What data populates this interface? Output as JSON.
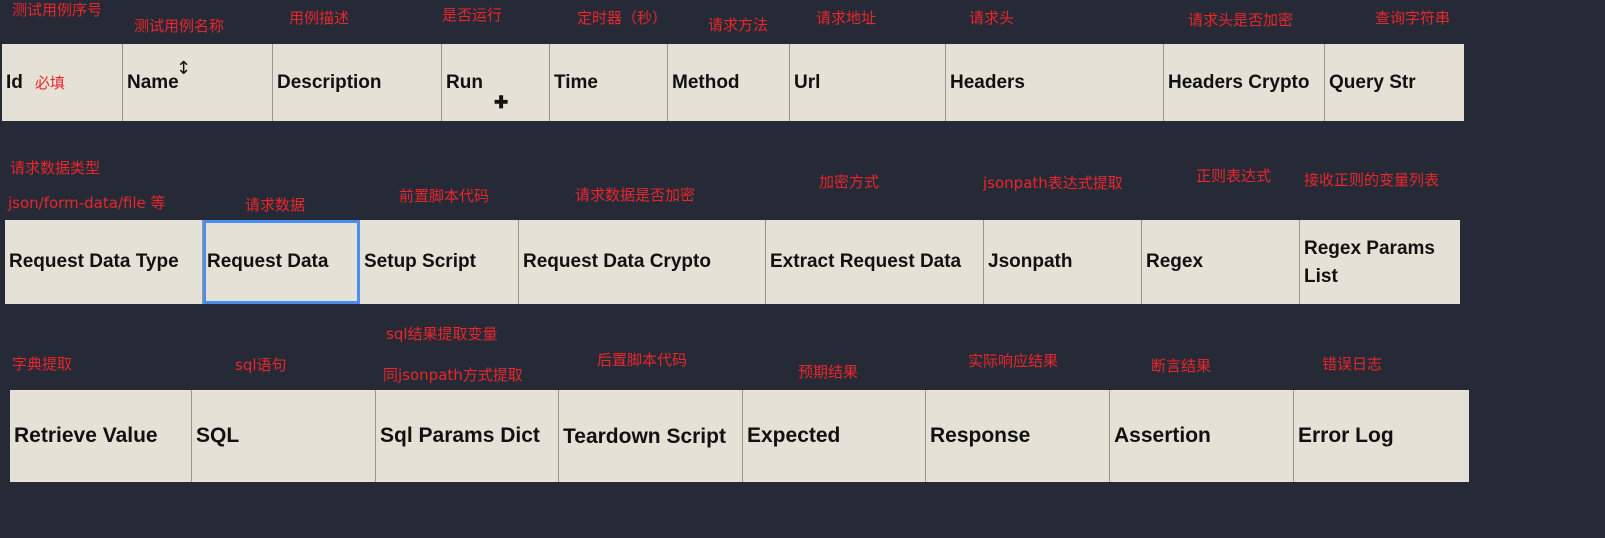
{
  "annotations_row1": [
    "测试用例序号",
    "测试用例名称",
    "用例描述",
    "是否运行",
    "定时器（秒）",
    "请求方法",
    "请求地址",
    "请求头",
    "请求头是否加密",
    "查询字符串"
  ],
  "annotations_row2": [
    "请求数据类型",
    "json/form-data/file 等",
    "请求数据",
    "前置脚本代码",
    "请求数据是否加密",
    "加密方式",
    "jsonpath表达式提取",
    "正则表达式",
    "接收正则的变量列表"
  ],
  "annotations_row3": [
    "字典提取",
    "sql语句",
    "sql结果提取变量",
    "同jsonpath方式提取",
    "后置脚本代码",
    "预期结果",
    "实际响应结果",
    "断言结果",
    "错误日志"
  ],
  "id_note": "必填",
  "row1": [
    "Id",
    "Name",
    "Description",
    "Run",
    "Time",
    "Method",
    "Url",
    "Headers",
    "Headers Crypto",
    "Query Str"
  ],
  "row2": [
    "Request Data Type",
    "Request Data",
    "Setup Script",
    "Request Data Crypto",
    "Extract Request Data",
    "Jsonpath",
    "Regex",
    "Regex Params List"
  ],
  "row3": [
    "Retrieve Value",
    "SQL",
    "Sql Params Dict",
    "Teardown Script",
    "Expected",
    "Response",
    "Assertion",
    "Error Log"
  ],
  "colors": {
    "background": "#262a36",
    "annotation": "#e8262c",
    "header_cell": "#e5e1d6",
    "selection": "#4a8ef0"
  },
  "icons": [
    "text-cursor-icon",
    "plus-cursor-icon"
  ]
}
